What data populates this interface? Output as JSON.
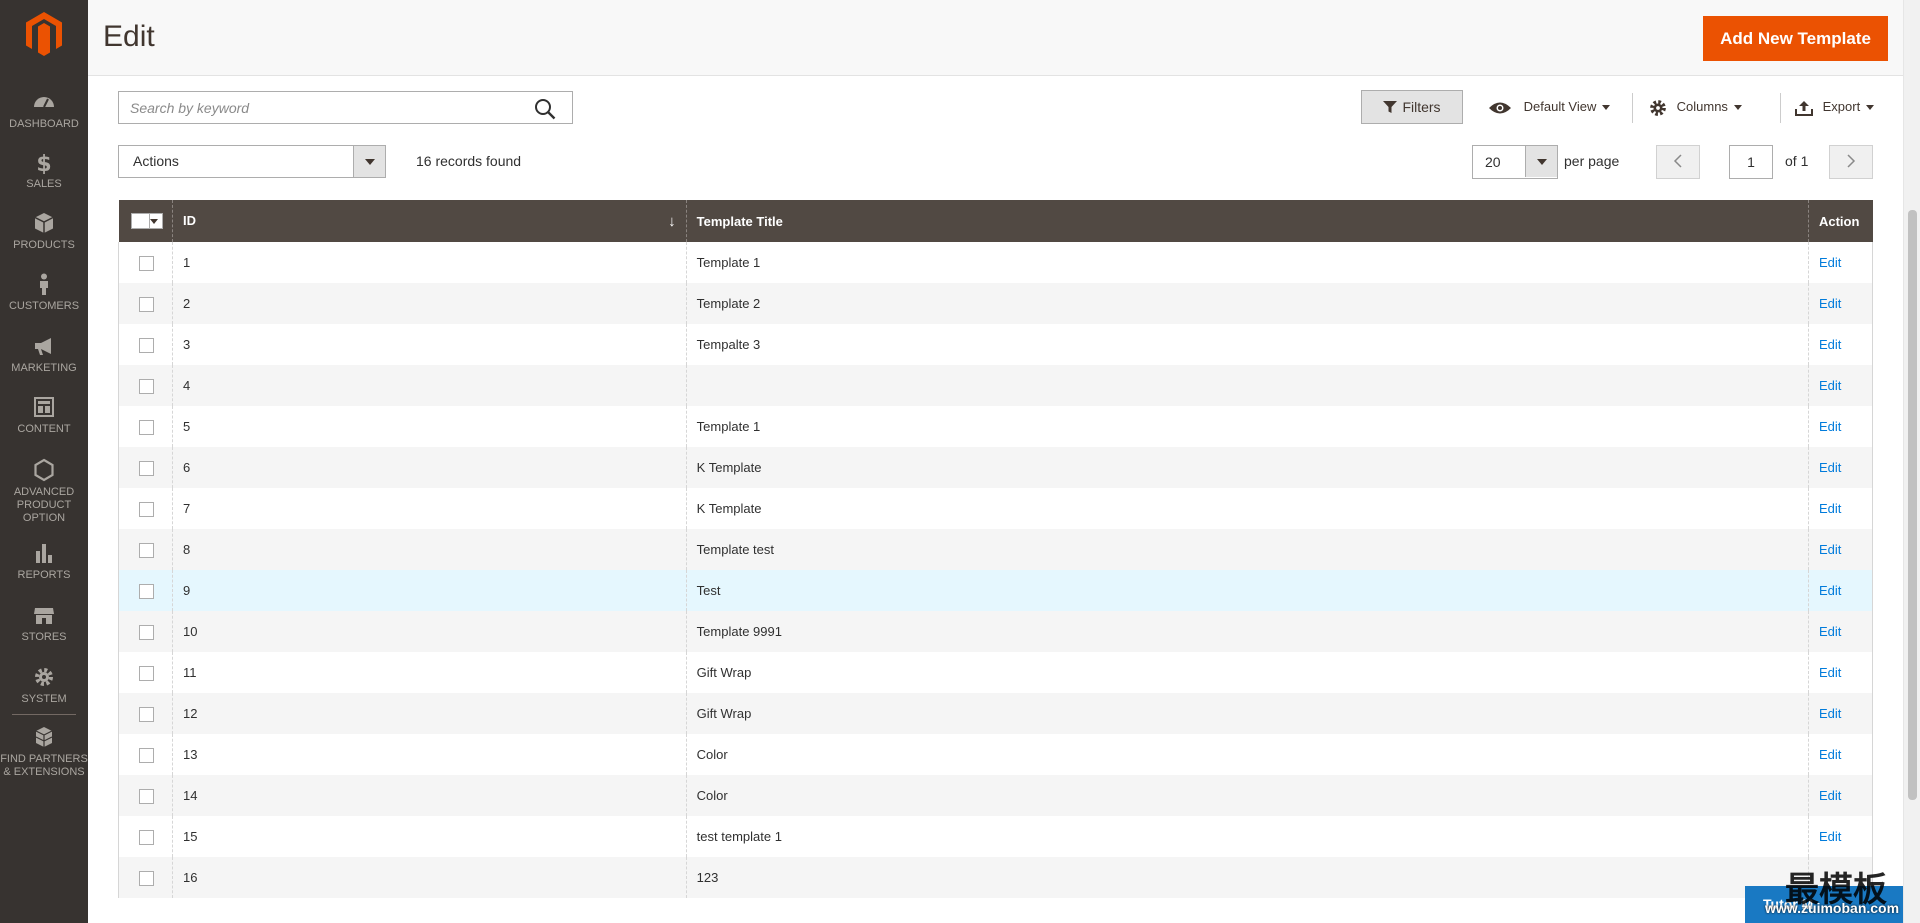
{
  "nav": {
    "items": [
      {
        "label": "DASHBOARD",
        "icon": "dashboard-icon"
      },
      {
        "label": "SALES",
        "icon": "dollar-icon"
      },
      {
        "label": "PRODUCTS",
        "icon": "cube-icon"
      },
      {
        "label": "CUSTOMERS",
        "icon": "person-icon"
      },
      {
        "label": "MARKETING",
        "icon": "megaphone-icon"
      },
      {
        "label": "CONTENT",
        "icon": "layout-icon"
      },
      {
        "label": "ADVANCED PRODUCT OPTION",
        "icon": "hexagon-icon"
      },
      {
        "label": "REPORTS",
        "icon": "bar-chart-icon"
      },
      {
        "label": "STORES",
        "icon": "store-icon"
      },
      {
        "label": "SYSTEM",
        "icon": "gear-icon"
      },
      {
        "label": "FIND PARTNERS & EXTENSIONS",
        "icon": "boxes-icon"
      }
    ]
  },
  "header": {
    "title": "Edit",
    "add_button": "Add New Template"
  },
  "toolbar": {
    "search_placeholder": "Search by keyword",
    "filters": "Filters",
    "view": "Default View",
    "columns": "Columns",
    "export": "Export",
    "actions": "Actions",
    "records": "16 records found",
    "per_page_value": "20",
    "per_page_label": "per page",
    "page_value": "1",
    "page_of": "of 1"
  },
  "grid": {
    "headers": {
      "id": "ID",
      "title": "Template Title",
      "action": "Action"
    },
    "sort_indicator": "↓",
    "action_label": "Edit",
    "rows": [
      {
        "id": "1",
        "title": "Template 1",
        "edit": true
      },
      {
        "id": "2",
        "title": "Template 2",
        "edit": true
      },
      {
        "id": "3",
        "title": "Tempalte 3",
        "edit": true
      },
      {
        "id": "4",
        "title": "",
        "edit": true
      },
      {
        "id": "5",
        "title": "Template 1",
        "edit": true
      },
      {
        "id": "6",
        "title": "K Template",
        "edit": true
      },
      {
        "id": "7",
        "title": "K Template",
        "edit": true
      },
      {
        "id": "8",
        "title": "Template test",
        "edit": true
      },
      {
        "id": "9",
        "title": "Test",
        "edit": true,
        "highlight": true
      },
      {
        "id": "10",
        "title": "Template 9991",
        "edit": true
      },
      {
        "id": "11",
        "title": "Gift Wrap",
        "edit": true
      },
      {
        "id": "12",
        "title": "Gift Wrap",
        "edit": true
      },
      {
        "id": "13",
        "title": "Color",
        "edit": true
      },
      {
        "id": "14",
        "title": "Color",
        "edit": true
      },
      {
        "id": "15",
        "title": "test template 1",
        "edit": true
      },
      {
        "id": "16",
        "title": "123",
        "edit": false
      }
    ]
  },
  "overlay": {
    "tutor_button": "Tutor M",
    "watermark": "最模板",
    "watermark_url": "www.zuimoban.com"
  },
  "colors": {
    "accent": "#eb5202",
    "sidebar": "#373330",
    "grid_header": "#514943",
    "link": "#007bdb"
  }
}
